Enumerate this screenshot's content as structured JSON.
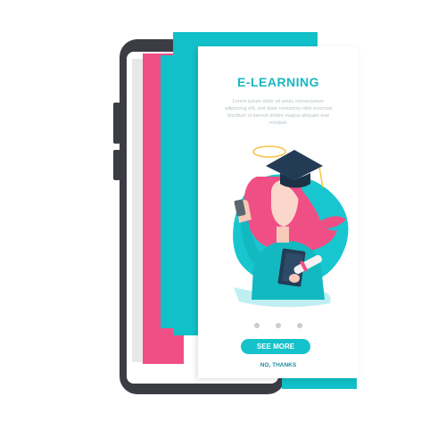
{
  "screen": {
    "title": "E-LEARNING",
    "body_text": "Lorem ipsum dolor sit amet, consectetuer adipiscing elit, sed diam nonummy nibh euismod tincidunt ut laoreet dolore magna aliquam erat volutpat.",
    "pagination_dots": 3,
    "primary_button": "SEE MORE",
    "secondary_link": "NO, THANKS"
  },
  "colors": {
    "teal": "#11c0c8",
    "pink": "#f04f86",
    "phone": "#3c3d44",
    "navy": "#243b55"
  },
  "icons": [
    "graduation-cap-icon",
    "smartphone-icon",
    "book-icon",
    "diploma-icon"
  ]
}
